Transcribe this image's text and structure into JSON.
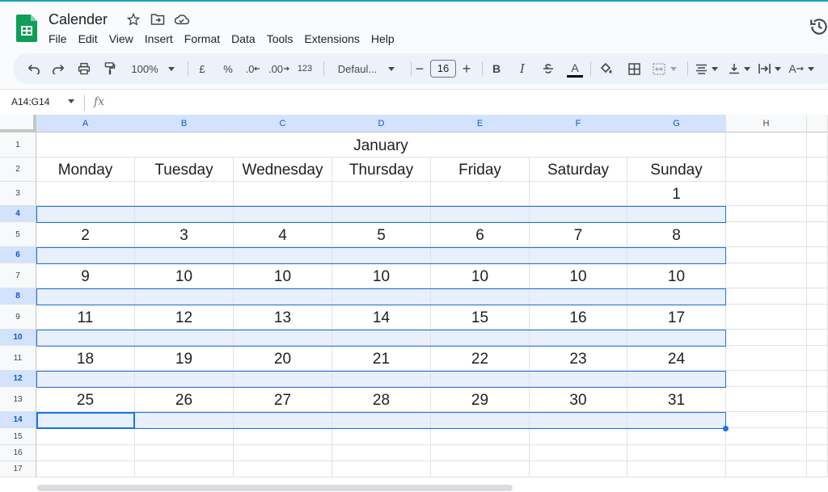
{
  "app": {
    "doc_title": "Calender",
    "menu": [
      "File",
      "Edit",
      "View",
      "Insert",
      "Format",
      "Data",
      "Tools",
      "Extensions",
      "Help"
    ]
  },
  "toolbar": {
    "zoom": "100%",
    "currency": "£",
    "percent": "%",
    "dec_decrease": ".0",
    "dec_increase": ".00",
    "format_123": "123",
    "font": "Defaul...",
    "font_size": "16",
    "minus": "−",
    "plus": "+",
    "bold": "B",
    "italic": "I",
    "text_color_label": "A",
    "text_rotation_label": "A"
  },
  "formula_bar": {
    "name_box": "A14:G14",
    "fx": "fx",
    "value": ""
  },
  "columns": [
    "A",
    "B",
    "C",
    "D",
    "E",
    "F",
    "G",
    "H"
  ],
  "rows": [
    "1",
    "2",
    "3",
    "4",
    "5",
    "6",
    "7",
    "8",
    "9",
    "10",
    "11",
    "12",
    "13",
    "14",
    "15",
    "16",
    "17"
  ],
  "selected_rows": [
    "4",
    "6",
    "8",
    "10",
    "12",
    "14"
  ],
  "sheet": {
    "month": "January",
    "weekdays": [
      "Monday",
      "Tuesday",
      "Wednesday",
      "Thursday",
      "Friday",
      "Saturday",
      "Sunday"
    ],
    "weeks": [
      [
        "",
        "",
        "",
        "",
        "",
        "",
        "1"
      ],
      [
        "2",
        "3",
        "4",
        "5",
        "6",
        "7",
        "8"
      ],
      [
        "9",
        "10",
        "10",
        "10",
        "10",
        "10",
        "10"
      ],
      [
        "11",
        "12",
        "13",
        "14",
        "15",
        "16",
        "17"
      ],
      [
        "18",
        "19",
        "20",
        "21",
        "22",
        "23",
        "24"
      ],
      [
        "25",
        "26",
        "27",
        "28",
        "29",
        "30",
        "31"
      ]
    ]
  },
  "colors": {
    "selection": "#1a73e8",
    "selection_fill": "#e8f0fe",
    "header_selected": "#d3e3fd",
    "sheets_green": "#0f9d58"
  }
}
